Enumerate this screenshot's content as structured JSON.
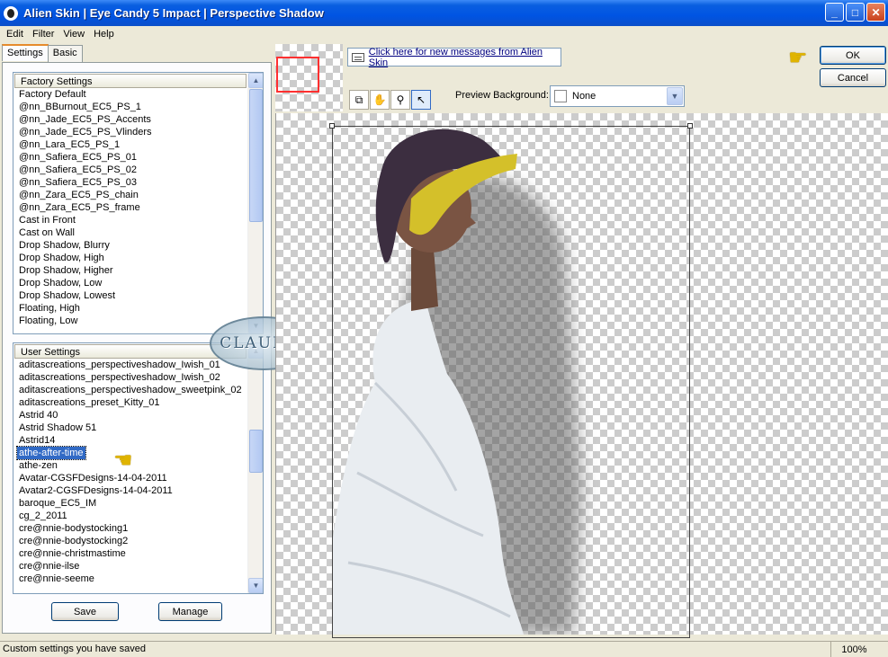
{
  "window": {
    "title": "Alien Skin | Eye Candy 5 Impact | Perspective Shadow",
    "minimize_icon": "minimize-icon",
    "maximize_icon": "maximize-icon",
    "close_icon": "close-icon"
  },
  "menu": {
    "items": [
      "Edit",
      "Filter",
      "View",
      "Help"
    ]
  },
  "tabs": {
    "settings_label": "Settings",
    "basic_label": "Basic",
    "active": "Settings"
  },
  "factory_settings": {
    "header": "Factory Settings",
    "items": [
      "Factory Default",
      "@nn_BBurnout_EC5_PS_1",
      "@nn_Jade_EC5_PS_Accents",
      "@nn_Jade_EC5_PS_Vlinders",
      "@nn_Lara_EC5_PS_1",
      "@nn_Safiera_EC5_PS_01",
      "@nn_Safiera_EC5_PS_02",
      "@nn_Safiera_EC5_PS_03",
      "@nn_Zara_EC5_PS_chain",
      "@nn_Zara_EC5_PS_frame",
      "Cast in Front",
      "Cast on Wall",
      "Drop Shadow, Blurry",
      "Drop Shadow, High",
      "Drop Shadow, Higher",
      "Drop Shadow, Low",
      "Drop Shadow, Lowest",
      "Floating, High",
      "Floating, Low"
    ]
  },
  "user_settings": {
    "header": "User Settings",
    "items": [
      "aditascreations_perspectiveshadow_Iwish_01",
      "aditascreations_perspectiveshadow_Iwish_02",
      "aditascreations_perspectiveshadow_sweetpink_02",
      "aditascreations_preset_Kitty_01",
      "Astrid 40",
      "Astrid Shadow 51",
      "Astrid14",
      "athe-after-time",
      "athe-zen",
      "Avatar-CGSFDesigns-14-04-2011",
      "Avatar2-CGSFDesigns-14-04-2011",
      "baroque_EC5_IM",
      "cg_2_2011",
      "cre@nnie-bodystocking1",
      "cre@nnie-bodystocking2",
      "cre@nnie-christmastime",
      "cre@nnie-ilse",
      "cre@nnie-seeme"
    ],
    "selected": "athe-after-time"
  },
  "buttons": {
    "save": "Save",
    "manage": "Manage",
    "ok": "OK",
    "cancel": "Cancel"
  },
  "preview": {
    "messages_link": "Click here for new messages from Alien Skin",
    "background_label": "Preview Background:",
    "background_value": "None",
    "tools": [
      "preview-toggle-icon",
      "hand-icon",
      "zoom-icon",
      "arrow-pointer-icon"
    ]
  },
  "watermark": {
    "text": "CLAUDIA"
  },
  "status": {
    "text": "Custom settings you have saved",
    "zoom": "100%"
  }
}
